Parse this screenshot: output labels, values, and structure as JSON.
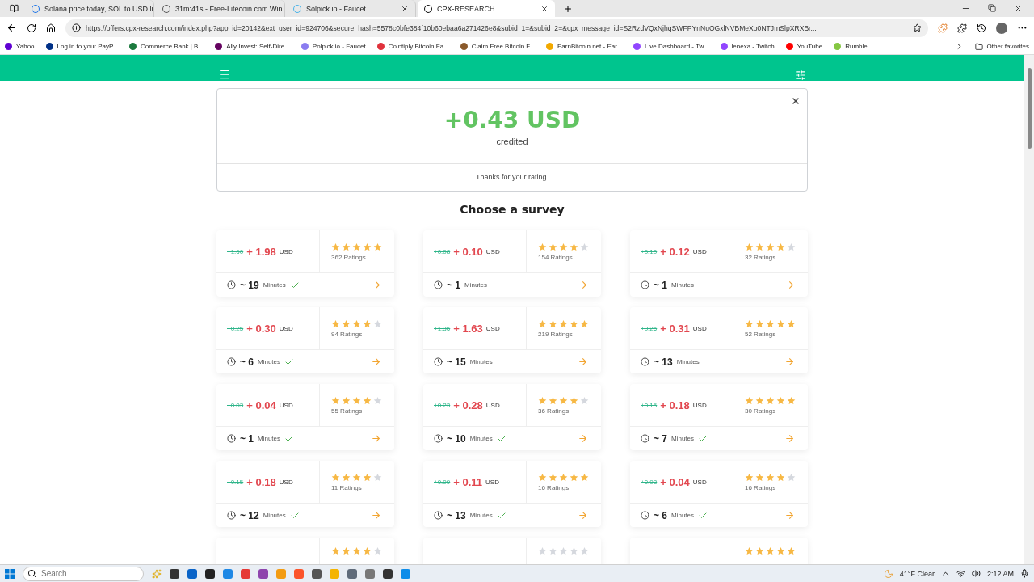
{
  "browser": {
    "tabs": [
      {
        "title": "Solana price today, SOL to USD li",
        "selected": false
      },
      {
        "title": "31m:41s - Free-Litecoin.com Win",
        "selected": false
      },
      {
        "title": "Solpick.io - Faucet",
        "selected": false
      },
      {
        "title": "CPX-RESEARCH",
        "selected": true
      }
    ],
    "address": "https://offers.cpx-research.com/index.php?app_id=20142&ext_user_id=924706&secure_hash=5578c0bfe384f10b60ebaa6a271426e8&subid_1=&subid_2=&cpx_message_id=S2RzdVQxNjhqSWFPYnNuOGxlNVBMeXo0NTJmSlpXRXBr...",
    "bookmarks": [
      {
        "label": "Yahoo",
        "color": "#6001d2"
      },
      {
        "label": "Log in to your PayP...",
        "color": "#003087"
      },
      {
        "label": "Commerce Bank | B...",
        "color": "#1b7a3e"
      },
      {
        "label": "Ally Invest: Self-Dire...",
        "color": "#650360"
      },
      {
        "label": "Polpick.io - Faucet",
        "color": "#8a7cf0"
      },
      {
        "label": "Cointiply Bitcoin Fa...",
        "color": "#e0323c"
      },
      {
        "label": "Claim Free Bitcoin F...",
        "color": "#8a5a2b"
      },
      {
        "label": "EarnBitcoin.net - Ear...",
        "color": "#f2a900"
      },
      {
        "label": "Live Dashboard - Tw...",
        "color": "#9146ff"
      },
      {
        "label": "lenexa - Twitch",
        "color": "#9146ff"
      },
      {
        "label": "YouTube",
        "color": "#ff0000"
      },
      {
        "label": "Rumble",
        "color": "#85c742"
      }
    ],
    "other_favorites": "Other favorites"
  },
  "popup": {
    "amount": "+0.43 USD",
    "note": "credited",
    "message": "Thanks for your rating."
  },
  "heading": "Choose a survey",
  "surveys": [
    {
      "old_price": "+1.60",
      "new_price": "+ 1.98",
      "currency": "USD",
      "stars": 5,
      "ratings": "362 Ratings",
      "minutes": "~ 19",
      "minutes_label": "Minutes",
      "verified": true
    },
    {
      "old_price": "+0.08",
      "new_price": "+ 0.10",
      "currency": "USD",
      "stars": 4,
      "ratings": "154 Ratings",
      "minutes": "~ 1",
      "minutes_label": "Minutes",
      "verified": false
    },
    {
      "old_price": "+0.10",
      "new_price": "+ 0.12",
      "currency": "USD",
      "stars": 4,
      "ratings": "32 Ratings",
      "minutes": "~ 1",
      "minutes_label": "Minutes",
      "verified": false
    },
    {
      "old_price": "+0.25",
      "new_price": "+ 0.30",
      "currency": "USD",
      "stars": 4,
      "ratings": "94 Ratings",
      "minutes": "~ 6",
      "minutes_label": "Minutes",
      "verified": true
    },
    {
      "old_price": "+1.36",
      "new_price": "+ 1.63",
      "currency": "USD",
      "stars": 5,
      "ratings": "219 Ratings",
      "minutes": "~ 15",
      "minutes_label": "Minutes",
      "verified": false
    },
    {
      "old_price": "+0.26",
      "new_price": "+ 0.31",
      "currency": "USD",
      "stars": 5,
      "ratings": "52 Ratings",
      "minutes": "~ 13",
      "minutes_label": "Minutes",
      "verified": false
    },
    {
      "old_price": "+0.03",
      "new_price": "+ 0.04",
      "currency": "USD",
      "stars": 4,
      "ratings": "55 Ratings",
      "minutes": "~ 1",
      "minutes_label": "Minutes",
      "verified": true
    },
    {
      "old_price": "+0.23",
      "new_price": "+ 0.28",
      "currency": "USD",
      "stars": 4,
      "ratings": "36 Ratings",
      "minutes": "~ 10",
      "minutes_label": "Minutes",
      "verified": true
    },
    {
      "old_price": "+0.15",
      "new_price": "+ 0.18",
      "currency": "USD",
      "stars": 5,
      "ratings": "30 Ratings",
      "minutes": "~ 7",
      "minutes_label": "Minutes",
      "verified": true
    },
    {
      "old_price": "+0.15",
      "new_price": "+ 0.18",
      "currency": "USD",
      "stars": 4,
      "ratings": "11 Ratings",
      "minutes": "~ 12",
      "minutes_label": "Minutes",
      "verified": true
    },
    {
      "old_price": "+0.09",
      "new_price": "+ 0.11",
      "currency": "USD",
      "stars": 5,
      "ratings": "16 Ratings",
      "minutes": "~ 13",
      "minutes_label": "Minutes",
      "verified": true
    },
    {
      "old_price": "+0.03",
      "new_price": "+ 0.04",
      "currency": "USD",
      "stars": 4,
      "ratings": "16 Ratings",
      "minutes": "~ 6",
      "minutes_label": "Minutes",
      "verified": true
    }
  ],
  "cut_surveys": [
    {
      "stars": 4
    },
    {
      "stars": 0
    },
    {
      "stars": 5
    }
  ],
  "taskbar": {
    "search_placeholder": "Search",
    "weather": "41°F Clear",
    "time": "2:12 AM"
  }
}
